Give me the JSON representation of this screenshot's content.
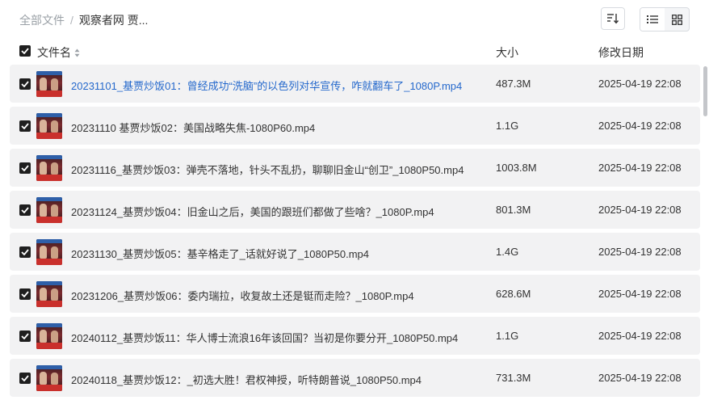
{
  "breadcrumb": {
    "root": "全部文件",
    "separator": "/",
    "current": "观察者网 贾..."
  },
  "header": {
    "name": "文件名",
    "size": "大小",
    "date": "修改日期"
  },
  "files": [
    {
      "name": "20231101_基贾炒饭01：曾经成功“洗脑”的以色列对华宣传，咋就翻车了_1080P.mp4",
      "size": "487.3M",
      "date": "2025-04-19 22:08"
    },
    {
      "name": "20231110 基贾炒饭02：美国战略失焦-1080P60.mp4",
      "size": "1.1G",
      "date": "2025-04-19 22:08"
    },
    {
      "name": "20231116_基贾炒饭03：弹壳不落地，针头不乱扔，聊聊旧金山“创卫”_1080P50.mp4",
      "size": "1003.8M",
      "date": "2025-04-19 22:08"
    },
    {
      "name": "20231124_基贾炒饭04：旧金山之后，美国的跟班们都做了些啥？_1080P.mp4",
      "size": "801.3M",
      "date": "2025-04-19 22:08"
    },
    {
      "name": "20231130_基贾炒饭05：基辛格走了_话就好说了_1080P50.mp4",
      "size": "1.4G",
      "date": "2025-04-19 22:08"
    },
    {
      "name": "20231206_基贾炒饭06：委内瑞拉，收复故土还是铤而走险？_1080P.mp4",
      "size": "628.6M",
      "date": "2025-04-19 22:08"
    },
    {
      "name": "20240112_基贾炒饭11：华人博士流浪16年该回国？当初是你要分开_1080P50.mp4",
      "size": "1.1G",
      "date": "2025-04-19 22:08"
    },
    {
      "name": "20240118_基贾炒饭12：_初选大胜！君权神授，听特朗普说_1080P50.mp4",
      "size": "731.3M",
      "date": "2025-04-19 22:08"
    }
  ]
}
